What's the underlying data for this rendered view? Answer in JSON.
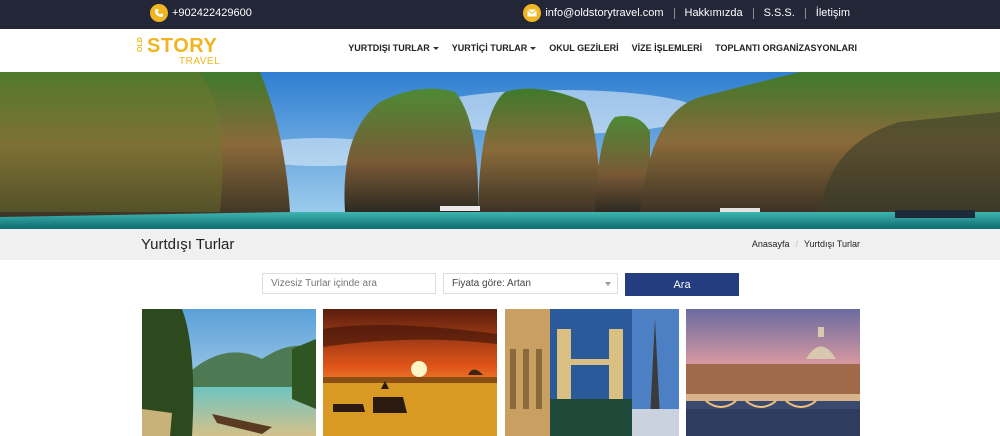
{
  "topbar": {
    "phone": "+902422429600",
    "email": "info@oldstorytravel.com",
    "links": [
      "Hakkımızda",
      "S.S.S.",
      "İletişim"
    ]
  },
  "header": {
    "logo": {
      "old": "OLD",
      "story": "STORY",
      "travel": "TRAVEL"
    },
    "nav": [
      {
        "label": "YURTDIŞI TURLAR",
        "dropdown": true
      },
      {
        "label": "YURTİÇİ TURLAR",
        "dropdown": true
      },
      {
        "label": "OKUL GEZİLERİ",
        "dropdown": false
      },
      {
        "label": "VİZE İŞLEMLERİ",
        "dropdown": false
      },
      {
        "label": "TOPLANTI ORGANİZASYONLARI",
        "dropdown": false
      }
    ]
  },
  "page": {
    "title": "Yurtdışı Turlar",
    "breadcrumb": [
      "Anasayfa",
      "Yurtdışı Turlar"
    ]
  },
  "search": {
    "placeholder": "Vizesiz Turlar içinde ara",
    "sort_selected": "Fiyata göre: Artan",
    "button_label": "Ara"
  },
  "tours": [
    {
      "image": "tropical-river-boat"
    },
    {
      "image": "safari-sunset-zebras"
    },
    {
      "image": "europe-landmarks-collage"
    },
    {
      "image": "rome-bridge-dusk"
    }
  ],
  "colors": {
    "topbar": "#232637",
    "accent": "#f1b521",
    "button": "#243c80",
    "titlebar": "#f0f0f0"
  }
}
